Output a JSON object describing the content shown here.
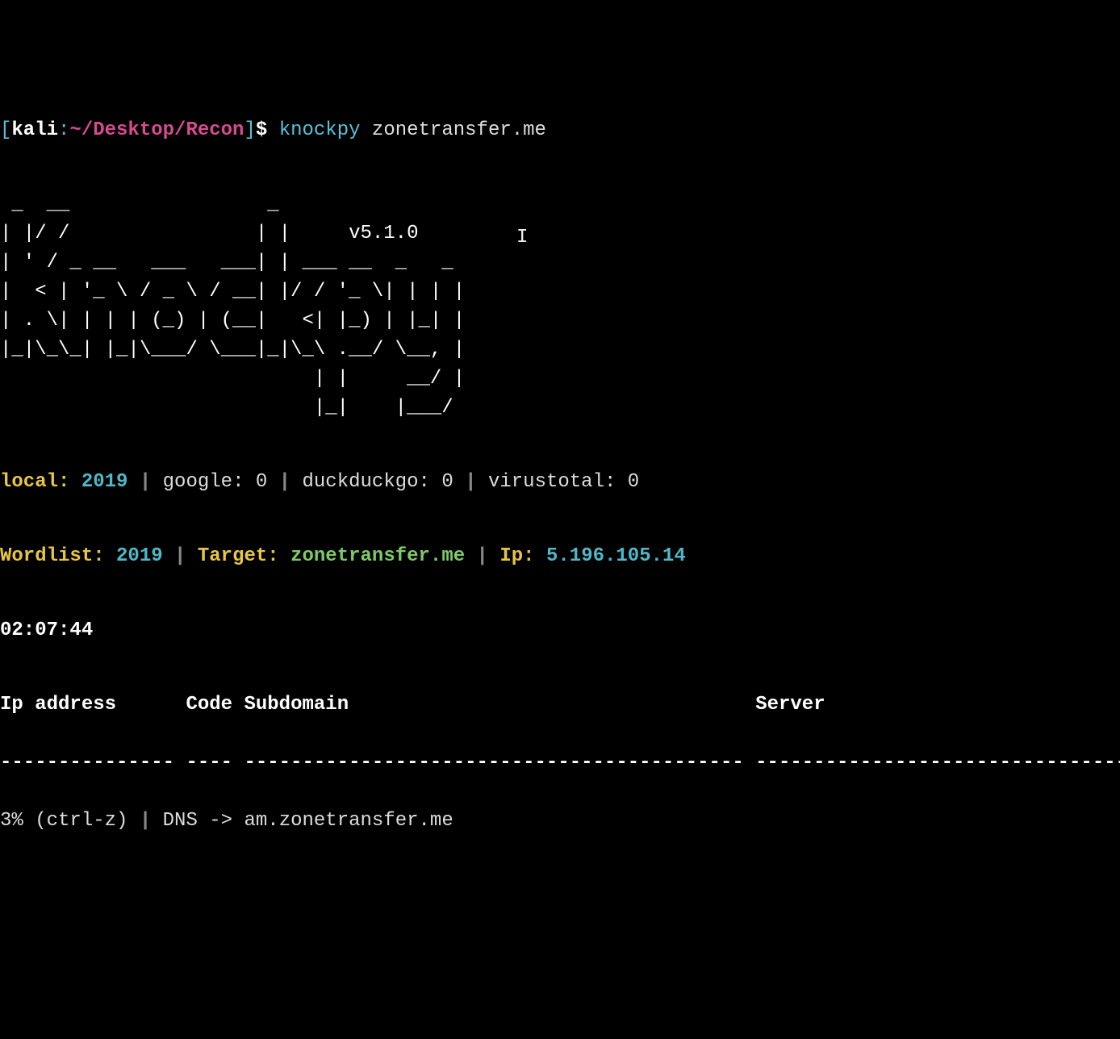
{
  "prompt": {
    "bracket_open": "[",
    "user": "kali",
    "colon": ":",
    "path": "~/Desktop/Recon",
    "bracket_close": "]",
    "dollar": "$",
    "cmd": "knockpy",
    "arg": "zonetransfer.me"
  },
  "art": " _  __                 _                \n| |/ /                | |     v5.1.0\n| ' / _ __   ___   ___| | ___ __  _   _ \n|  < | '_ \\ / _ \\ / __| |/ / '_ \\| | | |\n| . \\| | | | (_) | (__|   <| |_) | |_| |\n|_|\\_\\_| |_|\\___/ \\___|_|\\_\\ .__/ \\__, |\n                           | |     __/ |\n                           |_|    |___/ ",
  "stats": {
    "local_label": "local:",
    "local_value": "2019",
    "google_text": "google: 0",
    "ddg_text": "duckduckgo: 0",
    "vt_text": "virustotal: 0",
    "sep": " | "
  },
  "meta": {
    "wordlist_label": "Wordlist:",
    "wordlist_value": "2019",
    "target_label": "Target:",
    "target_value": "zonetransfer.me",
    "ip_label": "Ip:",
    "ip_value": "5.196.105.14",
    "sep": " | "
  },
  "time": "02:07:44",
  "headers": {
    "ip": "Ip address",
    "code": "Code",
    "subdomain": "Subdomain",
    "server": "Server"
  },
  "divider": "--------------- ---- ------------------------------------------- ---------------------------------------------",
  "status": {
    "percent": "3% (ctrl-z)",
    "sep": " | ",
    "dns_arrow": "DNS -> ",
    "current": "am.zonetransfer.me"
  },
  "cursor": "I"
}
